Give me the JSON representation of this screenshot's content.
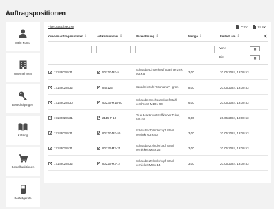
{
  "page": {
    "title": "Auftragspositionen"
  },
  "sidebar": {
    "items": [
      {
        "label": "Mein Konto",
        "icon": "user-icon"
      },
      {
        "label": "Unternehmen",
        "icon": "building-icon"
      },
      {
        "label": "Berechtigungen",
        "icon": "key-icon"
      },
      {
        "label": "Katalog",
        "icon": "book-icon"
      },
      {
        "label": "Bestellfunktionen",
        "icon": "cart-icon"
      },
      {
        "label": "Bestellgeräte",
        "icon": "handheld-device-icon"
      }
    ]
  },
  "toolbar": {
    "filter_reset": "Filter zurücksetzen",
    "csv": "CSV",
    "xlsx": "XLSX"
  },
  "table": {
    "columns": [
      "Kundenauftragsnummer",
      "Artikelnummer",
      "Bezeichnung",
      "Menge",
      "Erstellt am"
    ],
    "date_from": "Von:",
    "date_to": "Bis:",
    "rows": [
      {
        "order": "17189028531",
        "article": "50Z10-M3-5",
        "desc": "Schraube Linsenkopf Stahl verzinkt M3 x 5",
        "qty": "3,00",
        "created": "20.06.2024, 19:00:53"
      },
      {
        "order": "17189028532",
        "article": "845125",
        "desc": "Bürodrehstuhl \"Montana\" - grün",
        "qty": "8,00",
        "created": "20.06.2024, 19:00:53"
      },
      {
        "order": "17189028530",
        "article": "90230-M10-90",
        "desc": "Schraube Sechskantkopf Stahl verchromt M10 x 90",
        "qty": "6,00",
        "created": "20.06.2024, 19:00:53"
      },
      {
        "order": "17189028531",
        "article": "2115-P-10",
        "desc": "Glue Max Kunststoffkleber Tube, 100 ml",
        "qty": "9,00",
        "created": "20.06.2024, 19:00:53"
      },
      {
        "order": "17189028531",
        "article": "80Z10-M3-50",
        "desc": "Schraube Zylinderkopf Stahl verzinkt M3 x 50",
        "qty": "3,00",
        "created": "20.06.2024, 19:00:53"
      },
      {
        "order": "17189028531",
        "article": "80220-M3-25",
        "desc": "Schraube Zylinderkopf Stahl vernickelt M3 x 25",
        "qty": "3,00",
        "created": "20.06.2024, 19:00:53"
      },
      {
        "order": "17189028532",
        "article": "80220-M3-14",
        "desc": "Schraube Zylinderkopf Stahl vernickelt M3 x 14",
        "qty": "3,00",
        "created": "20.06.2024, 19:00:53"
      }
    ]
  },
  "colors": {
    "background": "#f2f2f2",
    "panel": "#ffffff",
    "icon": "#4a4a4a"
  }
}
